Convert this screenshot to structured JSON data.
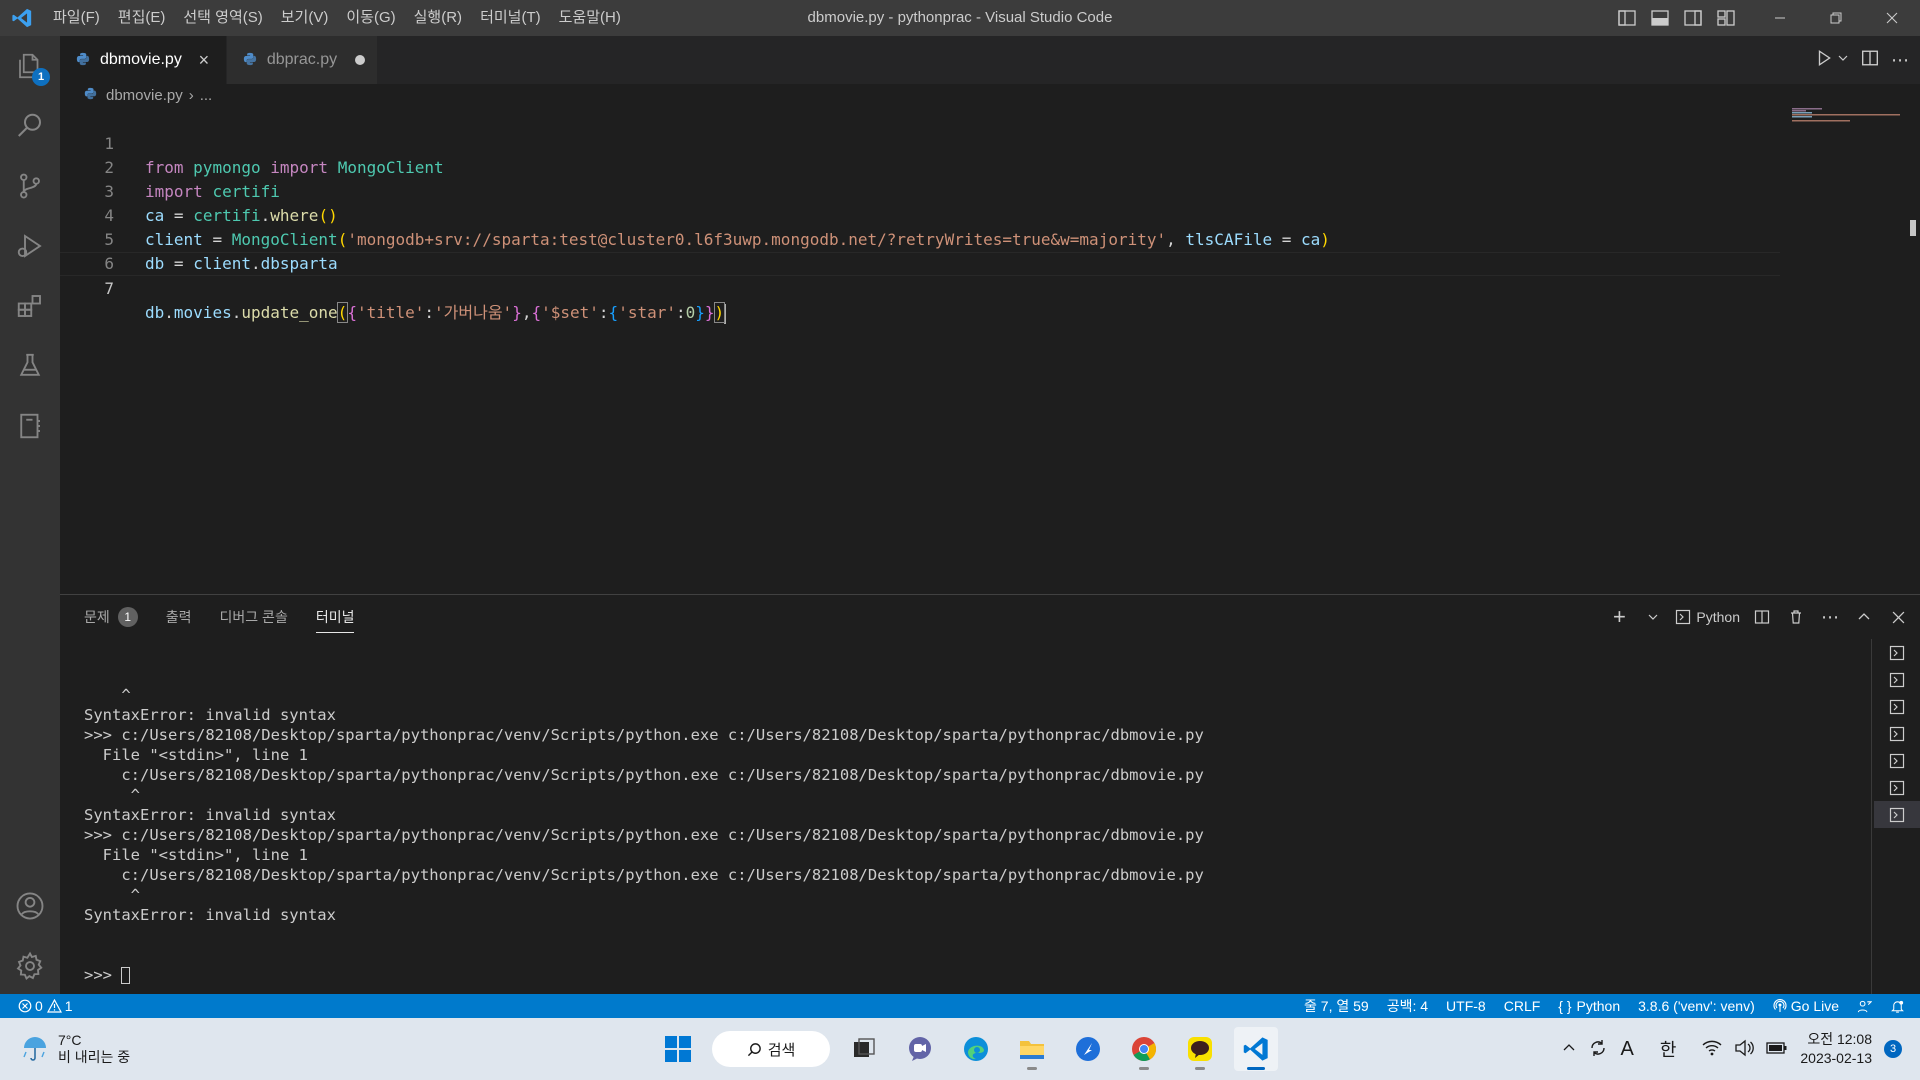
{
  "titlebar": {
    "menu": [
      "파일(F)",
      "편집(E)",
      "선택 영역(S)",
      "보기(V)",
      "이동(G)",
      "실행(R)",
      "터미널(T)",
      "도움말(H)"
    ],
    "window_title": "dbmovie.py - pythonprac - Visual Studio Code"
  },
  "activitybar": {
    "explorer_badge": "1"
  },
  "tabs": [
    {
      "label": "dbmovie.py",
      "state": "active"
    },
    {
      "label": "dbprac.py",
      "state": "modified"
    }
  ],
  "breadcrumb": {
    "file": "dbmovie.py",
    "rest": "..."
  },
  "editor": {
    "line_numbers": [
      "1",
      "2",
      "3",
      "4",
      "5",
      "6",
      "7"
    ],
    "current_line": 7,
    "lines": [
      "from pymongo import MongoClient",
      "import certifi",
      "ca = certifi.where()",
      "client = MongoClient('mongodb+srv://sparta:test@cluster0.l6f3uwp.mongodb.net/?retryWrites=true&w=majority', tlsCAFile = ca)",
      "db = client.dbsparta",
      "",
      "db.movies.update_one({'title':'가버나움'},{'$set':{'star':0}})"
    ]
  },
  "panel": {
    "tabs": [
      {
        "label": "문제",
        "badge": "1"
      },
      {
        "label": "출력"
      },
      {
        "label": "디버그 콘솔"
      },
      {
        "label": "터미널",
        "active": true
      }
    ],
    "terminal_profile": "Python",
    "terminal_lines": [
      "    ^",
      "SyntaxError: invalid syntax",
      ">>> c:/Users/82108/Desktop/sparta/pythonprac/venv/Scripts/python.exe c:/Users/82108/Desktop/sparta/pythonprac/dbmovie.py",
      "  File \"<stdin>\", line 1",
      "    c:/Users/82108/Desktop/sparta/pythonprac/venv/Scripts/python.exe c:/Users/82108/Desktop/sparta/pythonprac/dbmovie.py",
      "     ^",
      "SyntaxError: invalid syntax",
      ">>> c:/Users/82108/Desktop/sparta/pythonprac/venv/Scripts/python.exe c:/Users/82108/Desktop/sparta/pythonprac/dbmovie.py",
      "  File \"<stdin>\", line 1",
      "    c:/Users/82108/Desktop/sparta/pythonprac/venv/Scripts/python.exe c:/Users/82108/Desktop/sparta/pythonprac/dbmovie.py",
      "     ^",
      "SyntaxError: invalid syntax"
    ],
    "prompt": ">>> ",
    "terminal_instances": 7
  },
  "statusbar": {
    "errors": "0",
    "warnings": "1",
    "position": "줄 7, 열 59",
    "indent": "공백: 4",
    "encoding": "UTF-8",
    "eol": "CRLF",
    "language": "Python",
    "interpreter": "3.8.6 ('venv': venv)",
    "golive": "Go Live"
  },
  "taskbar": {
    "temperature": "7°C",
    "weather": "비 내리는 중",
    "search": "검색",
    "ime_lang": "A",
    "ime_mode": "한",
    "time": "오전 12:08",
    "date": "2023-02-13",
    "notifications": "3"
  },
  "colors": {
    "accent": "#007acc",
    "titlebar": "#3c3c3c",
    "activitybar": "#333333",
    "editor_bg": "#1e1e1e"
  }
}
